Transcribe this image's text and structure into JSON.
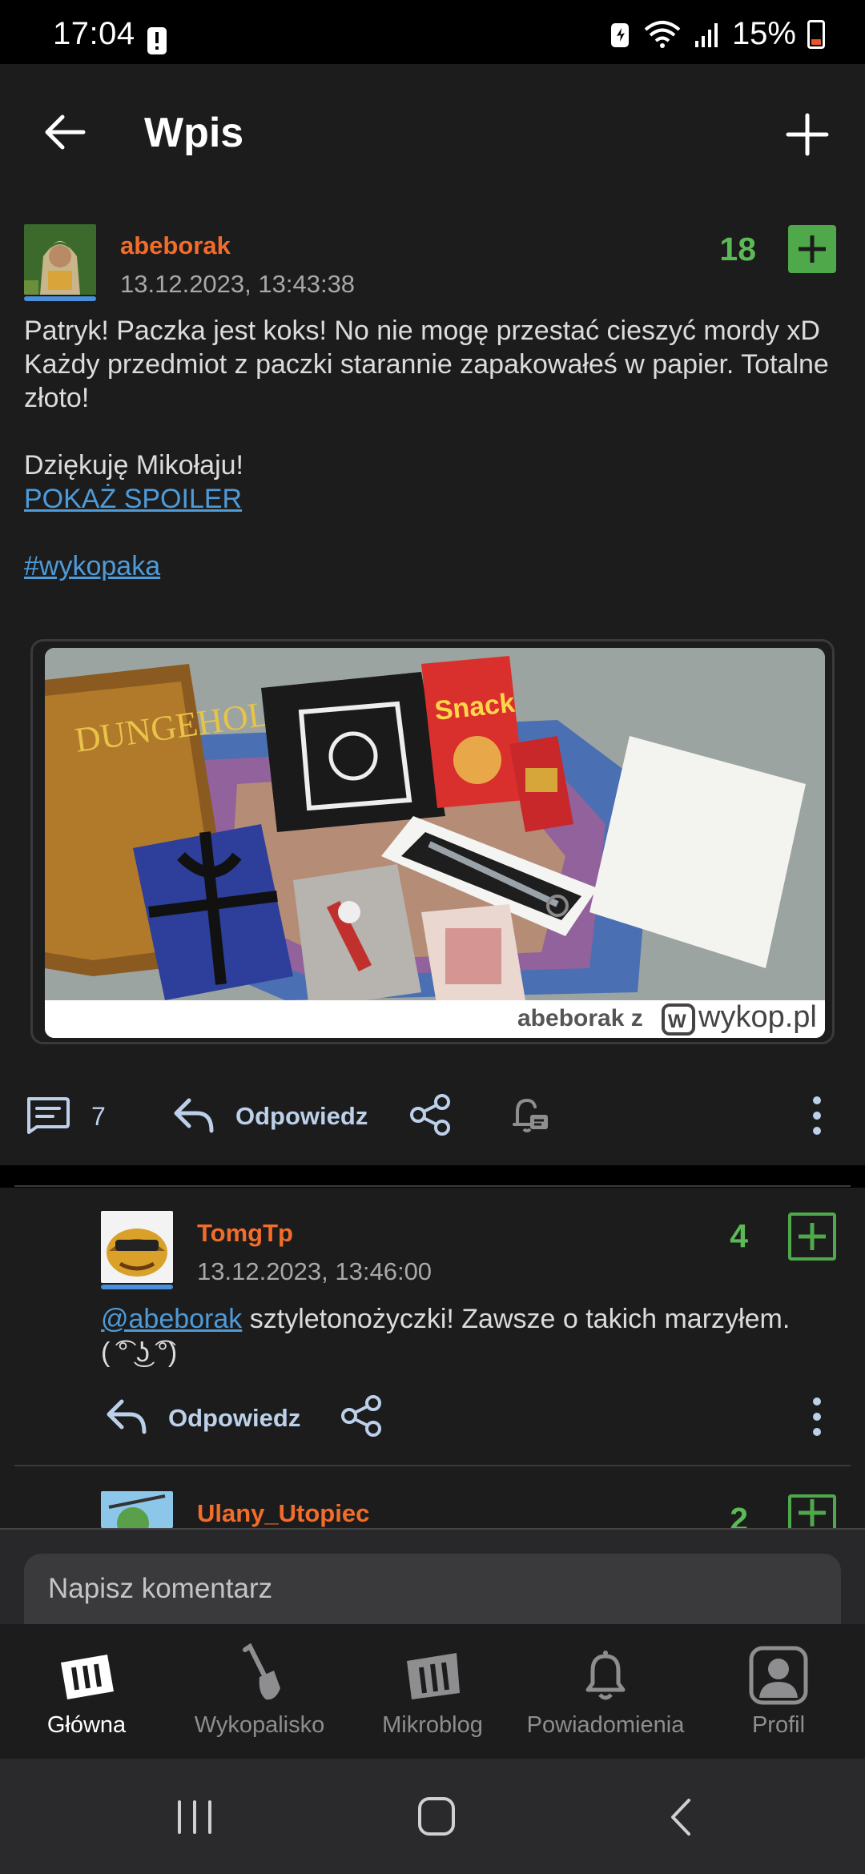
{
  "status_bar": {
    "time": "17:04",
    "battery": "15%"
  },
  "header": {
    "title": "Wpis",
    "back_icon": "arrow-left-icon",
    "add_icon": "plus-icon"
  },
  "post": {
    "author": "abeborak",
    "date": "13.12.2023, 13:43:38",
    "votes": "18",
    "lines": [
      "Patryk! Paczka jest koks! No nie mogę przestać cieszyć mordy xD",
      "Każdy przedmiot z paczki starannie zapakowałeś w papier. Totalne złoto!",
      "",
      "Dziękuję Mikołaju!"
    ],
    "spoiler_link": "POKAŻ SPOILER",
    "tag": "#wykopaka",
    "image_watermark": "abeborak z",
    "image_watermark_brand": "wykop.pl",
    "comments_count": "7",
    "reply_label": "Odpowiedz"
  },
  "comments": [
    {
      "author": "TomgTp",
      "date": "13.12.2023, 13:46:00",
      "votes": "4",
      "mention": "@abeborak",
      "text": " sztyletonożyczki! Zawsze o takich marzyłem.",
      "text2": "( ͡° ͜ʖ ͡°)",
      "reply_label": "Odpowiedz"
    },
    {
      "author": "Ulany_Utopiec",
      "votes": "2"
    }
  ],
  "composer": {
    "placeholder": "Napisz komentarz"
  },
  "bottom_nav": [
    {
      "label": "Główna",
      "icon": "home-logo-icon",
      "active": true
    },
    {
      "label": "Wykopalisko",
      "icon": "shovel-icon",
      "active": false
    },
    {
      "label": "Mikroblog",
      "icon": "mikroblog-icon",
      "active": false
    },
    {
      "label": "Powiadomienia",
      "icon": "bell-icon",
      "active": false
    },
    {
      "label": "Profil",
      "icon": "profile-icon",
      "active": false
    }
  ],
  "colors": {
    "accent_orange": "#f26c2a",
    "vote_green": "#5cba55",
    "link_blue": "#4e9bd8",
    "background": "#1c1c1d"
  }
}
